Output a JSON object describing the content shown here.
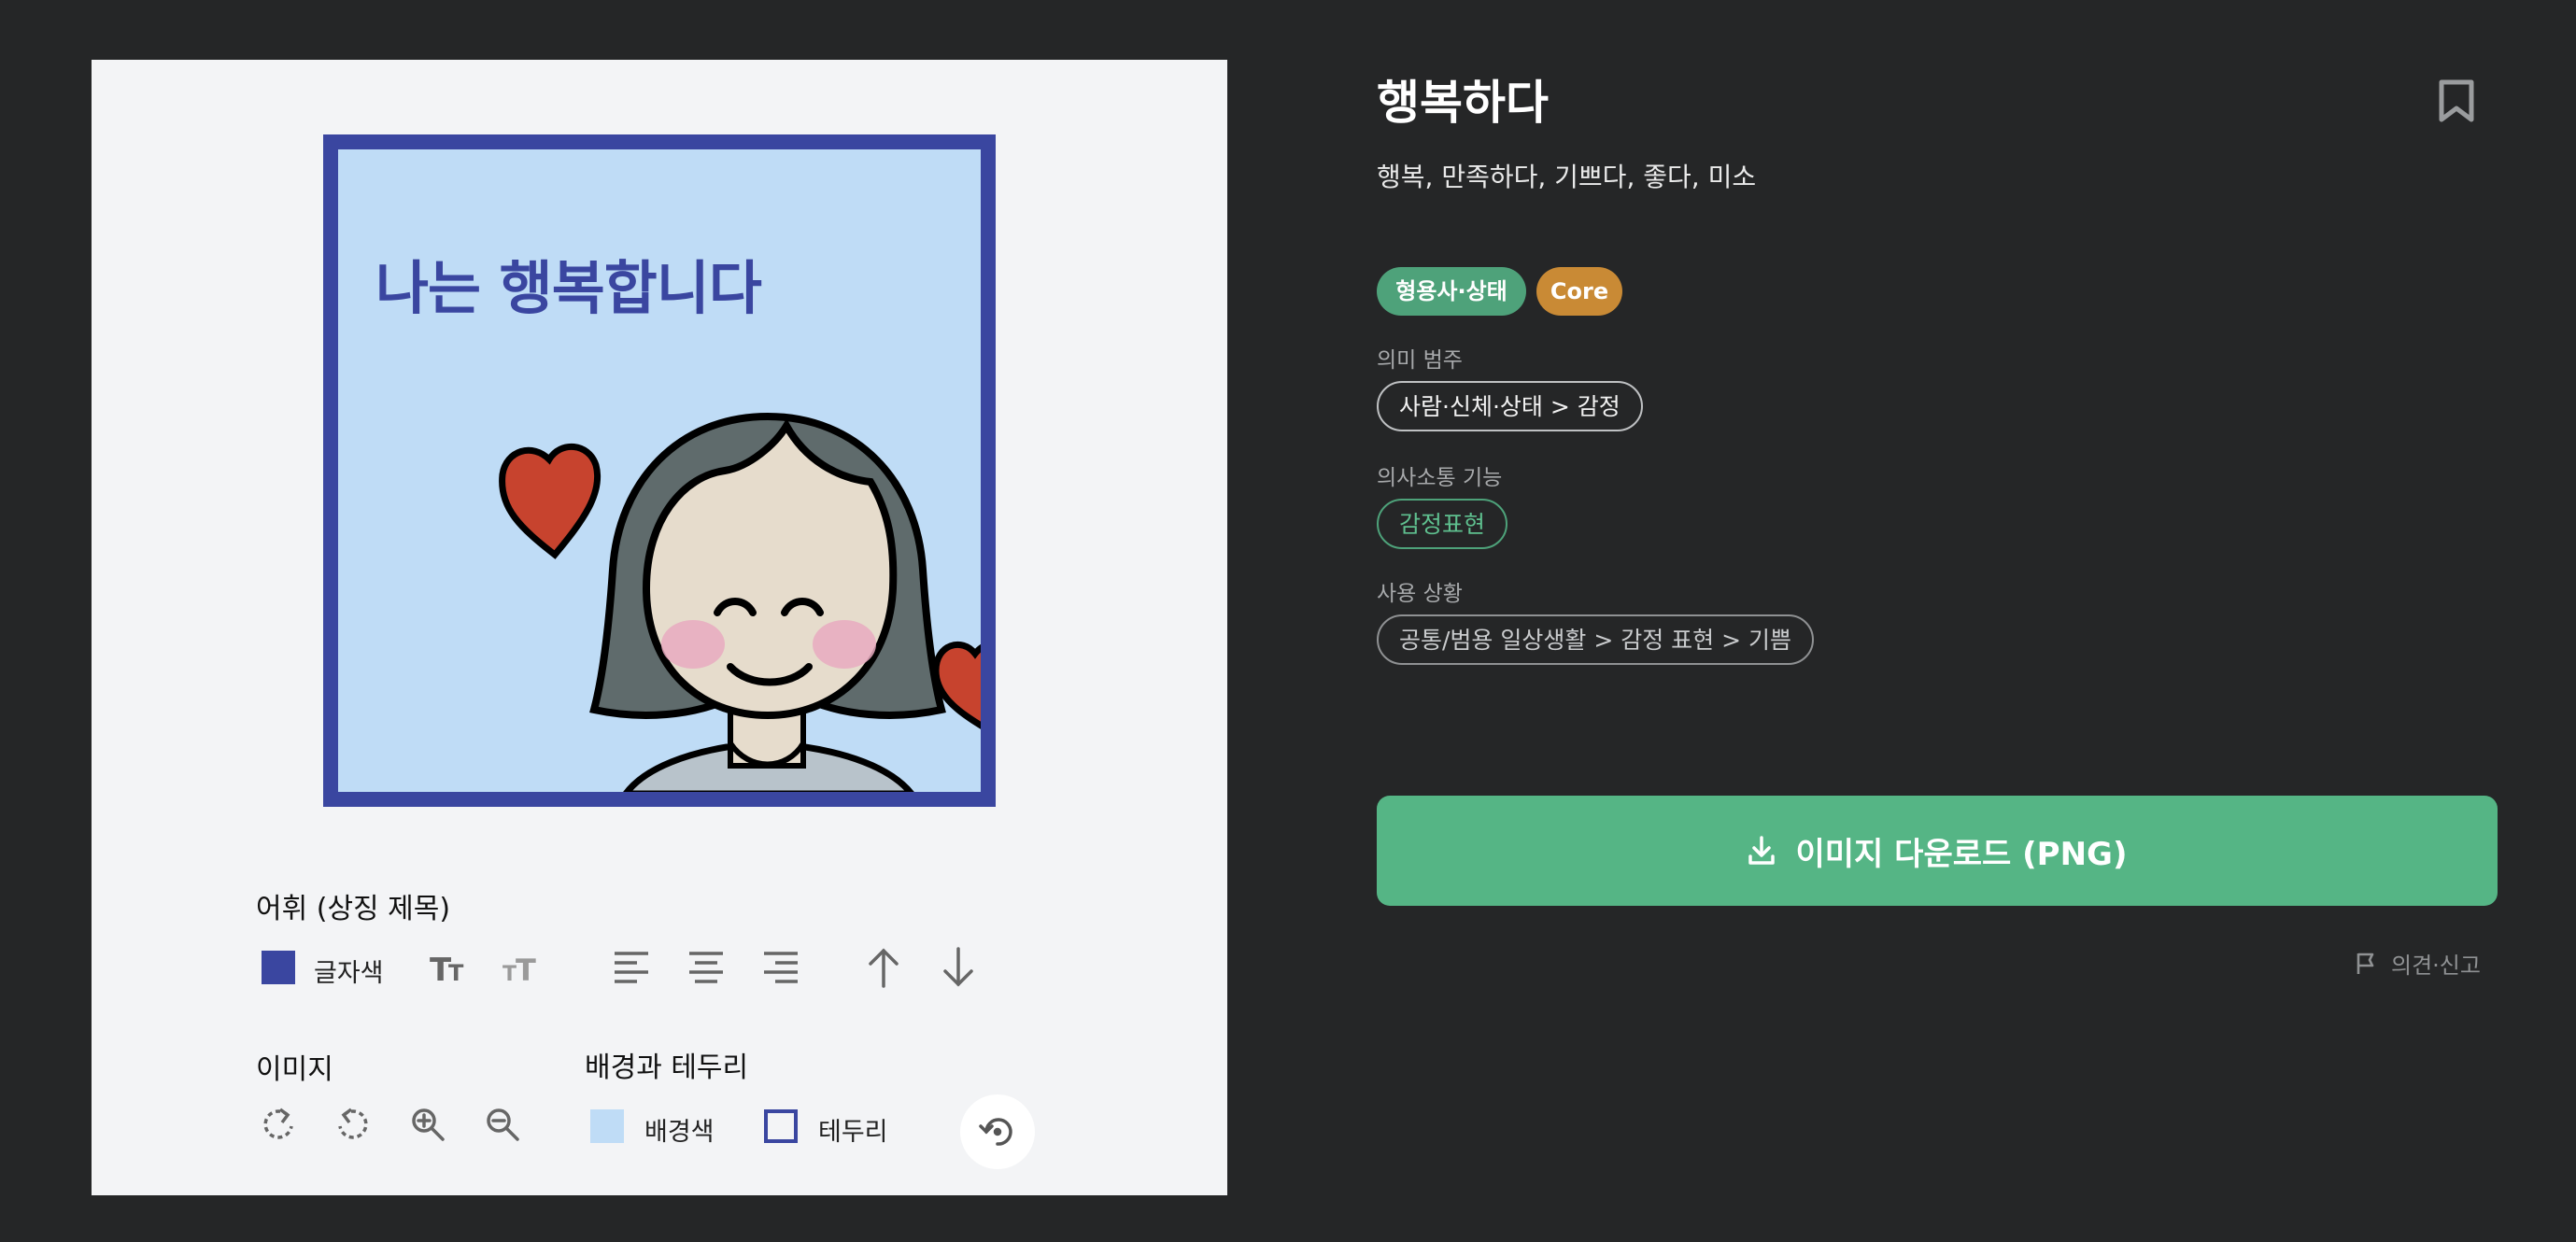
{
  "editor": {
    "preview_text": "나는 행복합니다",
    "section_word": "어휘 (상징 제목)",
    "text_color_label": "글자색",
    "section_image": "이미지",
    "section_background": "배경과 테두리",
    "bg_color_label": "배경색",
    "border_label": "테두리",
    "colors": {
      "text": "#3a46a0",
      "background": "#bfdcf6",
      "border": "#3a46a0",
      "panel": "#f3f4f6"
    },
    "icons": [
      "text-size-increase-icon",
      "text-size-decrease-icon",
      "align-left-icon",
      "align-center-icon",
      "align-right-icon",
      "move-up-icon",
      "move-down-icon",
      "rotate-right-icon",
      "rotate-left-icon",
      "zoom-in-icon",
      "zoom-out-icon",
      "reset-icon"
    ]
  },
  "detail": {
    "title": "행복하다",
    "synonyms": "행복, 만족하다, 기쁘다, 좋다, 미소",
    "badges": [
      {
        "label": "형용사·상태",
        "color": "#4ea27a"
      },
      {
        "label": "Core",
        "color": "#c98a35"
      }
    ],
    "meaning_category_label": "의미 범주",
    "meaning_category": "사람·신체·상태 > 감정",
    "communication_label": "의사소통 기능",
    "communication": "감정표현",
    "usage_label": "사용 상황",
    "usage": "공통/범용 일상생활 > 감정 표현 > 기쁨",
    "download_label": "이미지 다운로드 (PNG)",
    "report_label": "의견·신고",
    "accent": "#55b585"
  }
}
